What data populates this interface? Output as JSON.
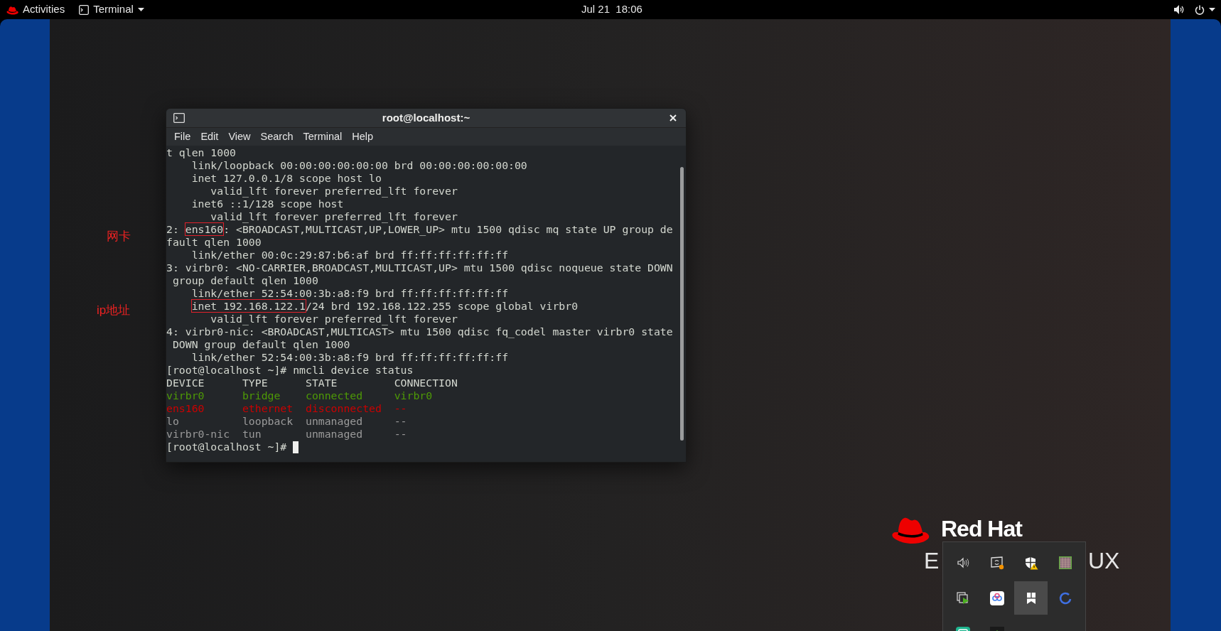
{
  "top_bar": {
    "activities": "Activities",
    "app_menu": "Terminal",
    "clock": "Jul 21  18:06"
  },
  "annotations": [
    {
      "text": "网卡"
    },
    {
      "text": "ip地址"
    }
  ],
  "terminal": {
    "title": "root@localhost:~",
    "menu": [
      "File",
      "Edit",
      "View",
      "Search",
      "Terminal",
      "Help"
    ],
    "lines": [
      {
        "segments": [
          {
            "text": "t qlen 1000",
            "boxed": false
          }
        ]
      },
      {
        "segments": [
          {
            "text": "    link/loopback 00:00:00:00:00:00 brd 00:00:00:00:00:00",
            "boxed": false
          }
        ]
      },
      {
        "segments": [
          {
            "text": "    inet 127.0.0.1/8 scope host lo",
            "boxed": false
          }
        ]
      },
      {
        "segments": [
          {
            "text": "       valid_lft forever preferred_lft forever",
            "boxed": false
          }
        ]
      },
      {
        "segments": [
          {
            "text": "    inet6 ::1/128 scope host",
            "boxed": false
          }
        ]
      },
      {
        "segments": [
          {
            "text": "       valid_lft forever preferred_lft forever",
            "boxed": false
          }
        ]
      },
      {
        "segments": [
          {
            "text": "2: ",
            "boxed": false
          },
          {
            "text": "ens160",
            "boxed": true
          },
          {
            "text": ": <BROADCAST,MULTICAST,UP,LOWER_UP> mtu 1500 qdisc mq state UP group de",
            "boxed": false
          }
        ]
      },
      {
        "segments": [
          {
            "text": "fault qlen 1000",
            "boxed": false
          }
        ]
      },
      {
        "segments": [
          {
            "text": "    link/ether 00:0c:29:87:b6:af brd ff:ff:ff:ff:ff:ff",
            "boxed": false
          }
        ]
      },
      {
        "segments": [
          {
            "text": "3: virbr0: <NO-CARRIER,BROADCAST,MULTICAST,UP> mtu 1500 qdisc noqueue state DOWN",
            "boxed": false
          }
        ]
      },
      {
        "segments": [
          {
            "text": " group default qlen 1000",
            "boxed": false
          }
        ]
      },
      {
        "segments": [
          {
            "text": "    link/ether 52:54:00:3b:a8:f9 brd ff:ff:ff:ff:ff:ff",
            "boxed": false
          }
        ]
      },
      {
        "segments": [
          {
            "text": "    inet 192.168.122.1",
            "boxed": true
          },
          {
            "text": "/24 brd 192.168.122.255 scope global virbr0",
            "boxed": false
          }
        ]
      },
      {
        "segments": [
          {
            "text": "       valid_lft forever preferred_lft forever",
            "boxed": false
          }
        ]
      },
      {
        "segments": [
          {
            "text": "4: virbr0-nic: <BROADCAST,MULTICAST> mtu 1500 qdisc fq_codel master virbr0 state",
            "boxed": false
          }
        ]
      },
      {
        "segments": [
          {
            "text": " DOWN group default qlen 1000",
            "boxed": false
          }
        ]
      },
      {
        "segments": [
          {
            "text": "    link/ether 52:54:00:3b:a8:f9 brd ff:ff:ff:ff:ff:ff",
            "boxed": false
          }
        ]
      },
      {
        "segments": [
          {
            "text": "[root@localhost ~]# nmcli device status",
            "boxed": false
          }
        ]
      },
      {
        "segments": [
          {
            "text": "DEVICE      TYPE      STATE         CONNECTION",
            "boxed": false
          }
        ]
      },
      {
        "color": "#4e9a06",
        "segments": [
          {
            "text": "virbr0      bridge    connected     virbr0",
            "boxed": false
          }
        ]
      },
      {
        "color": "#cc0000",
        "segments": [
          {
            "text": "ens160      ethernet  disconnected  --",
            "boxed": false
          }
        ]
      },
      {
        "color": "#9a9a9a",
        "segments": [
          {
            "text": "lo          loopback  unmanaged     --",
            "boxed": false
          }
        ]
      },
      {
        "color": "#9a9a9a",
        "segments": [
          {
            "text": "virbr0-nic  tun       unmanaged     --",
            "boxed": false
          }
        ]
      }
    ],
    "prompt": "[root@localhost ~]# "
  },
  "logo": {
    "name": "Red Hat",
    "line2_left": "E",
    "line2_right": "UX"
  },
  "tray": [
    {
      "kind": "speaker",
      "selected": false
    },
    {
      "kind": "sync-screen",
      "selected": false
    },
    {
      "kind": "shield",
      "selected": false
    },
    {
      "kind": "grid",
      "selected": false
    },
    {
      "kind": "screen-play",
      "selected": false
    },
    {
      "kind": "cloud-app",
      "selected": false
    },
    {
      "kind": "bookmark",
      "selected": true
    },
    {
      "kind": "ring",
      "selected": false
    },
    {
      "kind": "green-app",
      "selected": false
    },
    {
      "kind": "dark-app",
      "selected": false
    }
  ]
}
